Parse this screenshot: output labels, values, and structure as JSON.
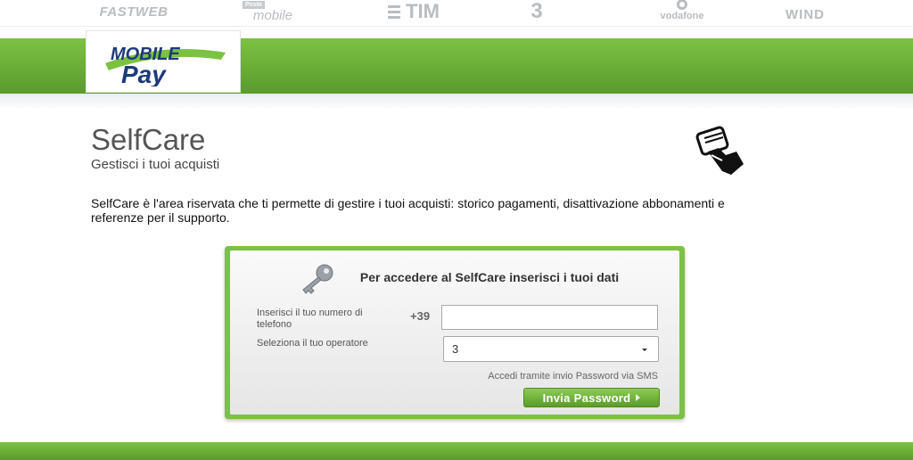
{
  "operators": {
    "fastweb": "FASTWEB",
    "poste_small": "Poste",
    "poste_big": "mobile",
    "tim": "TIM",
    "three": "3",
    "vodafone": "vodafone",
    "wind": "WIND"
  },
  "logo": {
    "line1": "MOBILE",
    "line2": "Pay"
  },
  "page": {
    "title": "SelfCare",
    "subtitle": "Gestisci i tuoi acquisti",
    "intro": "SelfCare è l'area riservata che ti permette di gestire i tuoi acquisti: storico pagamenti, disattivazione abbonamenti e referenze per il supporto."
  },
  "login": {
    "title": "Per accedere al SelfCare inserisci i tuoi dati",
    "phone_label": "Inserisci il tuo numero di telefono",
    "prefix": "+39",
    "phone_value": "",
    "operator_label": "Seleziona il tuo operatore",
    "operator_selected": "3",
    "sms_note": "Accedi tramite invio Password via SMS",
    "submit_label": "Invia Password"
  },
  "colors": {
    "brand_green": "#7cc242",
    "brand_dark_green": "#5a9b2c",
    "logo_blue": "#1d3a7a"
  }
}
